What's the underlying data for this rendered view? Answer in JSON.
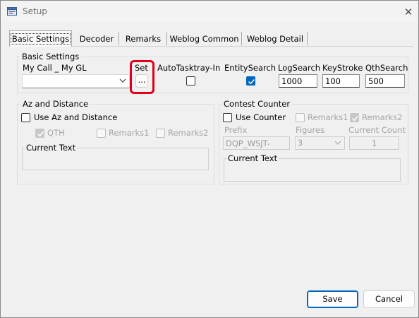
{
  "window": {
    "title": "Setup"
  },
  "tabs": [
    {
      "label": "Basic Settings"
    },
    {
      "label": "Decoder"
    },
    {
      "label": "Remarks"
    },
    {
      "label": "Weblog Common"
    },
    {
      "label": "Weblog Detail"
    }
  ],
  "basic": {
    "group_label": "Basic Settings",
    "mycall_label": "My Call _ My GL",
    "mycall_value": "",
    "set_label": "Set",
    "set_button": "...",
    "autotasktray_label": "AutoTasktray-In",
    "autotasktray_checked": false,
    "entitysearch_label": "EntitySearch",
    "entitysearch_checked": true,
    "logsearch_label": "LogSearch",
    "logsearch_value": "1000",
    "keystroke_label": "KeyStroke",
    "keystroke_value": "100",
    "qthsearch_label": "QthSearch",
    "qthsearch_value": "500"
  },
  "az": {
    "group_label": "Az and Distance",
    "use_label": "Use Az and Distance",
    "use_checked": false,
    "qth_label": "QTH",
    "qth_checked": true,
    "remarks1_label": "Remarks1",
    "remarks2_label": "Remarks2",
    "current_text_label": "Current Text",
    "current_text_value": ""
  },
  "contest": {
    "group_label": "Contest Counter",
    "use_label": "Use Counter",
    "use_checked": false,
    "remarks1_label": "Remarks1",
    "remarks2_label": "Remarks2",
    "remarks2_checked": true,
    "prefix_label": "Prefix",
    "prefix_value": "DQP_WSJT-",
    "figures_label": "Figures",
    "figures_value": "3",
    "current_count_label": "Current Count",
    "current_count_value": "1",
    "current_text_label": "Current Text",
    "current_text_value": ""
  },
  "footer": {
    "save_label": "Save",
    "cancel_label": "Cancel"
  },
  "colors": {
    "accent": "#0067c0",
    "highlight": "#e0001b"
  }
}
